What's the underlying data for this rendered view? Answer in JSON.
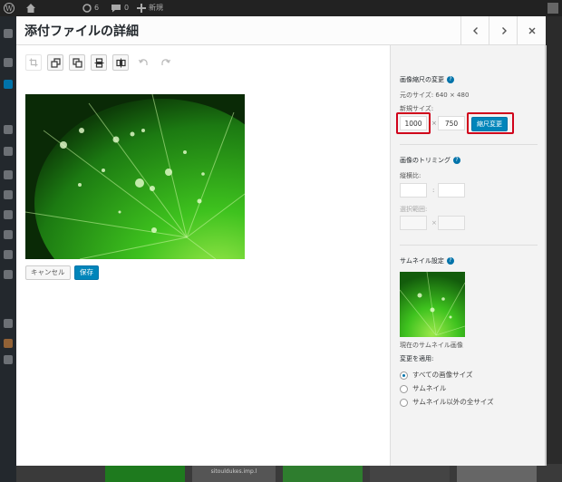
{
  "admin_bar": {
    "updates_count": "6",
    "comments_count": "0",
    "new_label": "新規"
  },
  "modal": {
    "title": "添付ファイルの詳細",
    "prev_icon": "chevron-left-icon",
    "next_icon": "chevron-right-icon",
    "close_icon": "close-icon"
  },
  "editor": {
    "toolbar": [
      "crop-icon",
      "rotate-left-icon",
      "rotate-right-icon",
      "flip-vertical-icon",
      "flip-horizontal-icon",
      "undo-icon",
      "redo-icon"
    ],
    "cancel_label": "キャンセル",
    "save_label": "保存"
  },
  "scale": {
    "title": "画像縮尺の変更",
    "original_size": "元のサイズ: 640 × 480",
    "new_size_label": "新規サイズ:",
    "width": "1000",
    "height": "750",
    "times": "×",
    "scale_button": "縮尺変更"
  },
  "crop": {
    "title": "画像のトリミング",
    "ratio_label": "縦横比:",
    "ratio_sep": ":",
    "selection_label": "選択範囲:",
    "selection_sep": "×"
  },
  "thumbnail": {
    "title": "サムネイル設定",
    "current_label": "現在のサムネイル画像",
    "apply_label": "変更を適用:",
    "options": [
      "すべての画像サイズ",
      "サムネイル",
      "サムネイル以外の全サイズ"
    ],
    "selected_index": 0
  },
  "background": {
    "filename": "sitouldukes.imp.l"
  },
  "colors": {
    "primary": "#0073aa",
    "highlight": "#d0021b"
  }
}
